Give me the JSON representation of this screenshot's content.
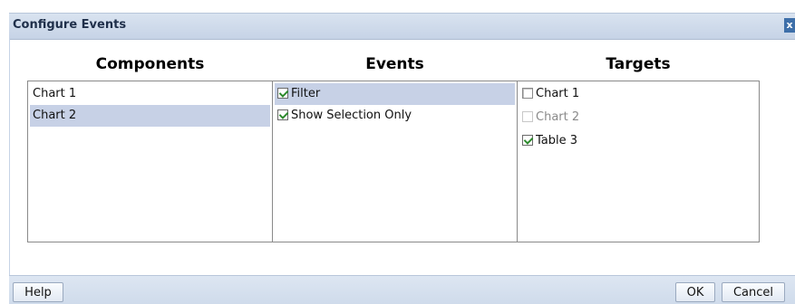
{
  "dialog": {
    "title": "Configure Events",
    "close_icon": "close-icon"
  },
  "columns": {
    "components": {
      "header": "Components",
      "items": [
        {
          "label": "Chart 1",
          "selected": false
        },
        {
          "label": "Chart 2",
          "selected": true
        }
      ]
    },
    "events": {
      "header": "Events",
      "items": [
        {
          "label": "Filter",
          "checked": true,
          "selected": true
        },
        {
          "label": "Show Selection Only",
          "checked": true,
          "selected": false
        }
      ]
    },
    "targets": {
      "header": "Targets",
      "items": [
        {
          "label": "Chart 1",
          "checked": false,
          "enabled": true
        },
        {
          "label": "Chart 2",
          "checked": false,
          "enabled": false
        },
        {
          "label": "Table 3",
          "checked": true,
          "enabled": true
        }
      ]
    }
  },
  "footer": {
    "help_label": "Help",
    "ok_label": "OK",
    "cancel_label": "Cancel"
  },
  "colors": {
    "selection": "#c7d1e6",
    "titlebar": "#c6d3e6",
    "checkmark": "#2c8a2c"
  }
}
